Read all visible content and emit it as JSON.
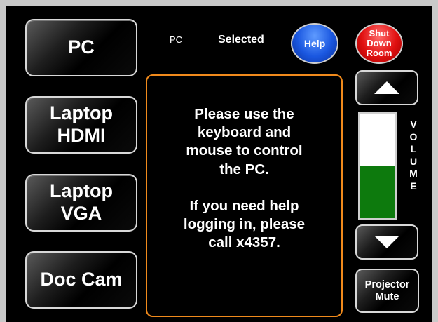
{
  "sources": [
    {
      "id": "pc",
      "label": "PC"
    },
    {
      "id": "laptop-hdmi",
      "label": "Laptop\nHDMI"
    },
    {
      "id": "laptop-vga",
      "label": "Laptop\nVGA"
    },
    {
      "id": "doc-cam",
      "label": "Doc Cam"
    }
  ],
  "status": {
    "source": "PC",
    "selected_label": "Selected"
  },
  "buttons": {
    "help": "Help",
    "shutdown": "Shut Down\nRoom",
    "projector_mute": "Projector\nMute"
  },
  "message": {
    "line1": "Please use the\nkeyboard and\nmouse to control\nthe PC.",
    "line2": "If you need help\nlogging in, please\ncall x4357."
  },
  "volume": {
    "label": "V\nO\nL\nU\nM\nE",
    "level_percent": 50,
    "fill_color": "#0d7a0d"
  },
  "icons": {
    "volume_up": "up-triangle-icon",
    "volume_down": "down-triangle-icon"
  },
  "colors": {
    "accent_border": "#f08a1c",
    "help": "#1a57e0",
    "shutdown": "#e01010"
  }
}
